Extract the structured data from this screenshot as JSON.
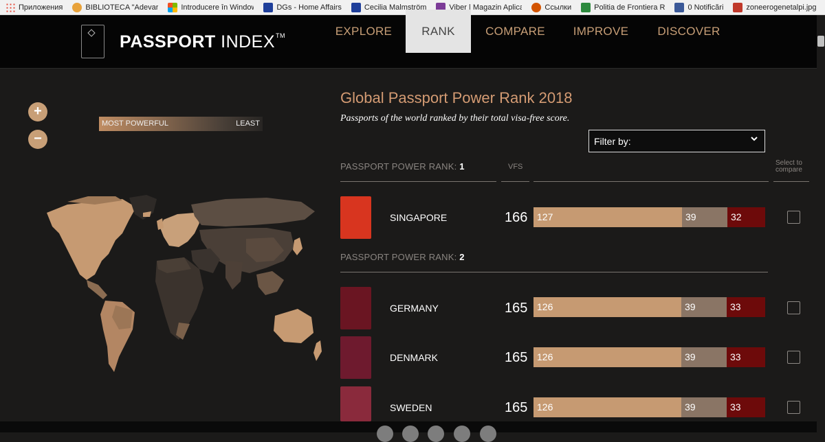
{
  "bookmarks": [
    {
      "label": "Приложения",
      "color": "#e74c3c",
      "icon": "apps-grid-icon"
    },
    {
      "label": "BIBLIOTECA \"Adevarul\"",
      "color": "#e8a23a",
      "icon": "gear-icon"
    },
    {
      "label": "Introducere în Windows",
      "color": "#2e86de",
      "icon": "windows-icon"
    },
    {
      "label": "DGs - Home Affairs",
      "color": "#1f3f9a",
      "icon": "eu-flag-icon"
    },
    {
      "label": "Cecilia Malmström",
      "color": "#1f3f9a",
      "icon": "eu-flag-icon"
    },
    {
      "label": "Viber | Magazin Aplicații",
      "color": "#7d3c98",
      "icon": "windows-icon"
    },
    {
      "label": "Ссылки",
      "color": "#d35400",
      "icon": "firefox-icon"
    },
    {
      "label": "Politia de Frontiera R",
      "color": "#2d8a3e",
      "icon": "crest-icon"
    },
    {
      "label": "0 Notificări",
      "color": "#3b5998",
      "icon": "facebook-icon"
    },
    {
      "label": "zoneerogenetalpi.jpg",
      "color": "#c0392b",
      "icon": "image-icon"
    }
  ],
  "header": {
    "logo_bold": "PASSPORT",
    "logo_rest": " INDEX",
    "logo_tm": "TM",
    "nav": [
      "EXPLORE",
      "RANK",
      "COMPARE",
      "IMPROVE",
      "DISCOVER"
    ],
    "active_nav": "RANK"
  },
  "map": {
    "zoom_in": "+",
    "zoom_out": "−",
    "legend_left": "MOST POWERFUL",
    "legend_right": "LEAST"
  },
  "ranking": {
    "title": "Global Passport Power Rank 2018",
    "subtitle": "Passports of the world ranked by their total visa-free score.",
    "filter_label": "Filter by:",
    "col_vfs": "VFS",
    "col_compare_1": "Select to",
    "col_compare_2": "compare",
    "rank_prefix": "PASSPORT POWER RANK: ",
    "rank1": "1",
    "rank2": "2",
    "rows": [
      {
        "country": "SINGAPORE",
        "vfs": "166",
        "a": "127",
        "b": "39",
        "c": "32",
        "passport_color": "#d8351f"
      },
      {
        "country": "GERMANY",
        "vfs": "165",
        "a": "126",
        "b": "39",
        "c": "33",
        "passport_color": "#6a1522"
      },
      {
        "country": "DENMARK",
        "vfs": "165",
        "a": "126",
        "b": "39",
        "c": "33",
        "passport_color": "#6e1a2e"
      },
      {
        "country": "SWEDEN",
        "vfs": "165",
        "a": "126",
        "b": "39",
        "c": "33",
        "passport_color": "#8a2a3c"
      }
    ]
  },
  "colors": {
    "accent": "#c89f77",
    "bar_visa_free": "#c69a72",
    "bar_visa_on_arrival": "#8a7565",
    "bar_eta": "#6d0a0a"
  }
}
